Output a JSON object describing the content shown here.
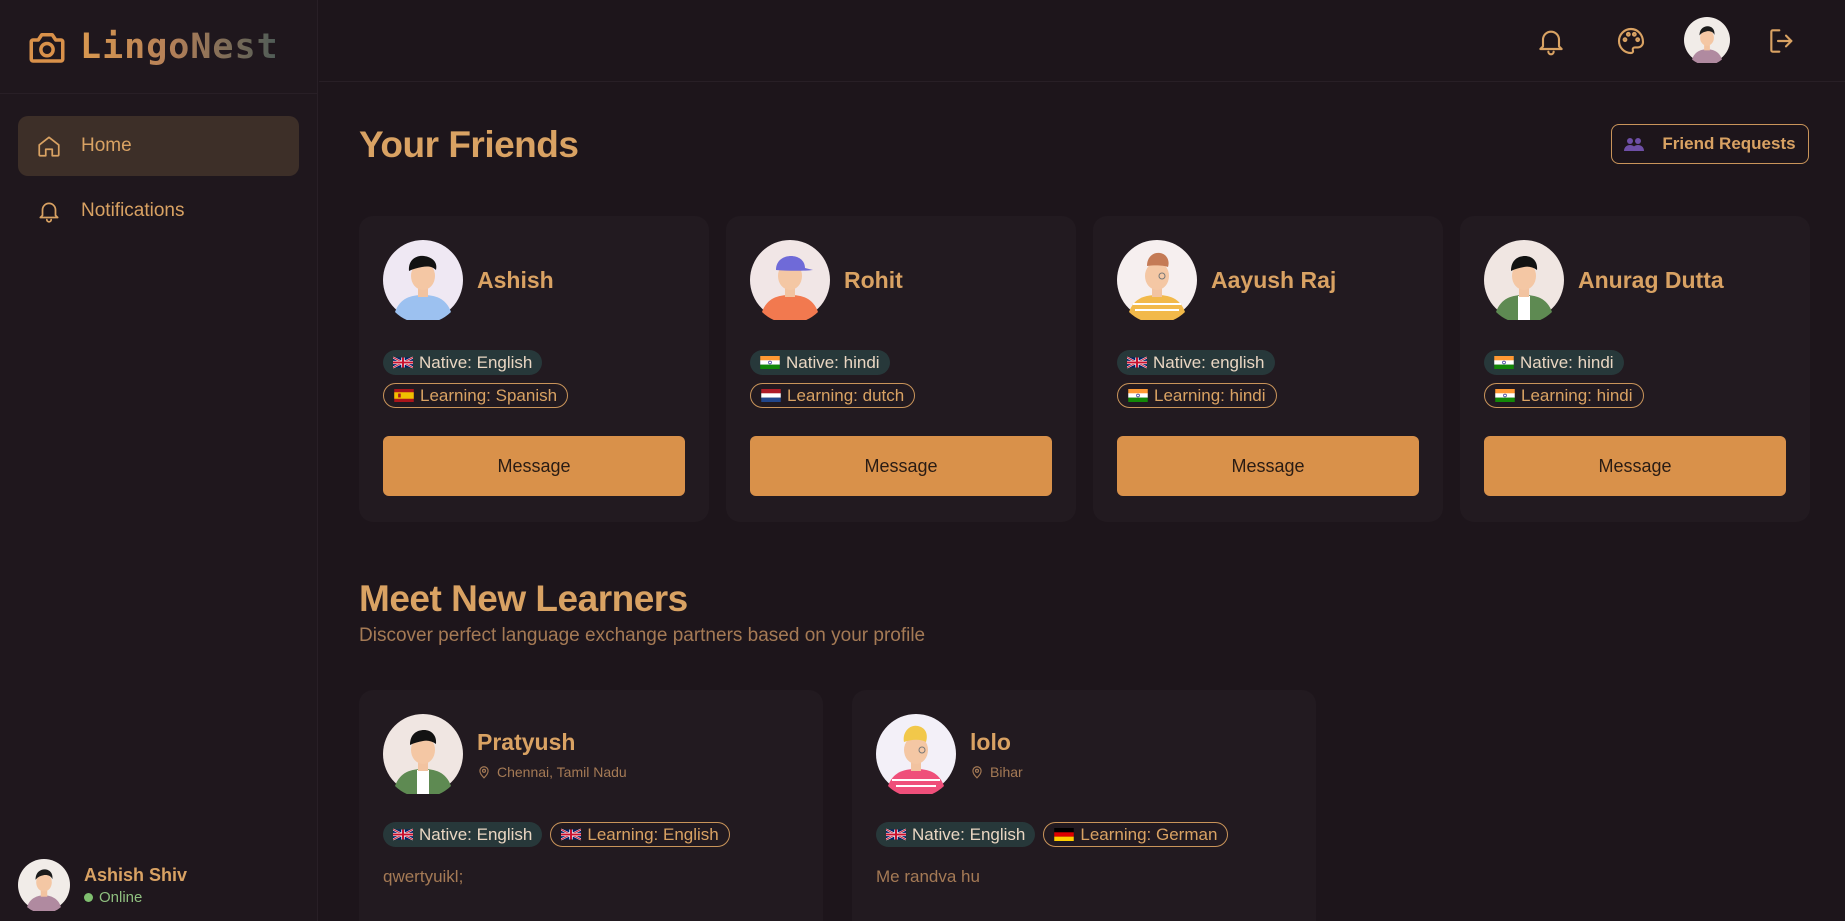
{
  "app": {
    "name": "LingoNest"
  },
  "sidebar": {
    "items": [
      {
        "label": "Home",
        "icon": "home-icon",
        "active": true
      },
      {
        "label": "Notifications",
        "icon": "bell-icon",
        "active": false
      }
    ],
    "user": {
      "name": "Ashish Shiv",
      "status": "Online"
    }
  },
  "topbar": {
    "icons": [
      "bell-icon",
      "palette-icon",
      "avatar",
      "logout-icon"
    ]
  },
  "friends": {
    "title": "Your Friends",
    "requests_label": "Friend Requests",
    "cards": [
      {
        "name": "Ashish",
        "native": "Native: English",
        "native_flag": "uk",
        "learning": "Learning: Spanish",
        "learning_flag": "es",
        "button": "Message"
      },
      {
        "name": "Rohit",
        "native": "Native: hindi",
        "native_flag": "in",
        "learning": "Learning: dutch",
        "learning_flag": "nl",
        "button": "Message"
      },
      {
        "name": "Aayush Raj",
        "native": "Native: english",
        "native_flag": "uk",
        "learning": "Learning: hindi",
        "learning_flag": "in",
        "button": "Message"
      },
      {
        "name": "Anurag Dutta",
        "native": "Native: hindi",
        "native_flag": "in",
        "learning": "Learning: hindi",
        "learning_flag": "in",
        "button": "Message"
      }
    ]
  },
  "learners": {
    "title": "Meet New Learners",
    "subtitle": "Discover perfect language exchange partners based on your profile",
    "cards": [
      {
        "name": "Pratyush",
        "location": "Chennai, Tamil Nadu",
        "native": "Native: English",
        "native_flag": "uk",
        "learning": "Learning: English",
        "learning_flag": "uk",
        "bio": "qwertyuikl;"
      },
      {
        "name": "lolo",
        "location": "Bihar",
        "native": "Native: English",
        "native_flag": "uk",
        "learning": "Learning: German",
        "learning_flag": "de",
        "bio": "Me randva hu"
      }
    ]
  },
  "colors": {
    "background": "#1d151b",
    "card": "#221a20",
    "accent": "#d9914a",
    "text_primary": "#d9a263",
    "native_badge_bg": "#27383a",
    "online": "#7fbf6f"
  }
}
